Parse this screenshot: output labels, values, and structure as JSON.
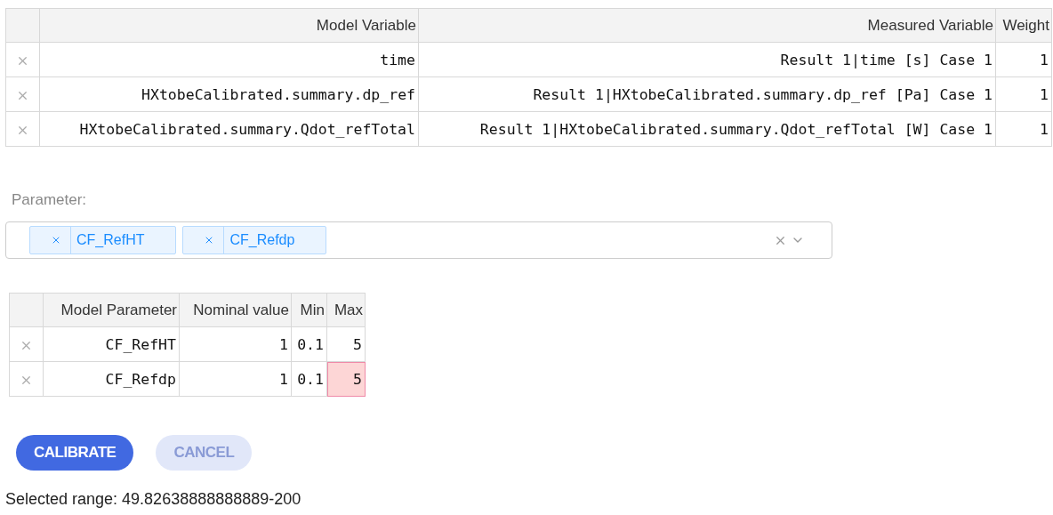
{
  "variables_table": {
    "columns": [
      "Model Variable",
      "Measured Variable",
      "Weight"
    ],
    "rows": [
      {
        "model_variable": "time",
        "measured_variable": "Result 1|time [s] Case 1",
        "weight": "1"
      },
      {
        "model_variable": "HXtobeCalibrated.summary.dp_ref",
        "measured_variable": "Result 1|HXtobeCalibrated.summary.dp_ref [Pa] Case 1",
        "weight": "1"
      },
      {
        "model_variable": "HXtobeCalibrated.summary.Qdot_refTotal",
        "measured_variable": "Result 1|HXtobeCalibrated.summary.Qdot_refTotal [W] Case 1",
        "weight": "1"
      }
    ]
  },
  "parameter_select": {
    "label": "Parameter:",
    "chips": [
      "CF_RefHT",
      "CF_Refdp"
    ]
  },
  "parameters_table": {
    "columns": [
      "Model Parameter",
      "Nominal value",
      "Min",
      "Max"
    ],
    "rows": [
      {
        "model_parameter": "CF_RefHT",
        "nominal_value": "1",
        "min": "0.1",
        "max": "5",
        "max_invalid": false
      },
      {
        "model_parameter": "CF_Refdp",
        "nominal_value": "1",
        "min": "0.1",
        "max": "5",
        "max_invalid": true
      }
    ]
  },
  "buttons": [
    {
      "label": "CALIBRATE",
      "disabled": false
    },
    {
      "label": "CANCEL",
      "disabled": true
    }
  ],
  "selected_range": "Selected range: 49.82638888888889-200"
}
